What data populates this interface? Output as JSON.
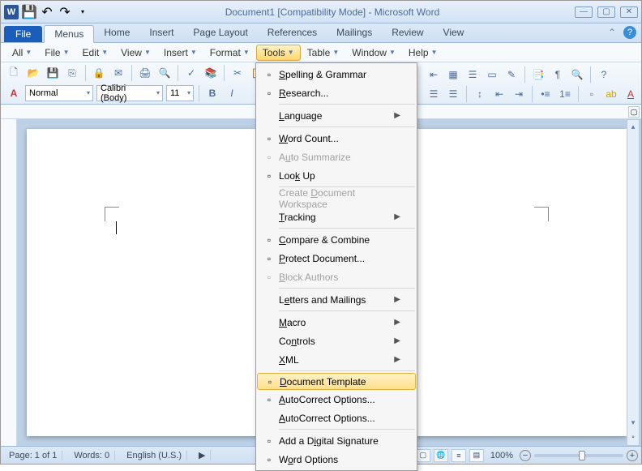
{
  "title": "Document1 [Compatibility Mode] - Microsoft Word",
  "ribbon_tabs": {
    "file": "File",
    "tabs": [
      "Menus",
      "Home",
      "Insert",
      "Page Layout",
      "References",
      "Mailings",
      "Review",
      "View"
    ],
    "active": "Menus"
  },
  "menubar": {
    "items": [
      "All",
      "File",
      "Edit",
      "View",
      "Insert",
      "Format",
      "Tools",
      "Table",
      "Window",
      "Help"
    ],
    "open": "Tools"
  },
  "format_bar": {
    "style_label": "Normal",
    "font_label": "Calibri (Body)",
    "size_label": "11",
    "style_prefix": "A"
  },
  "dropdown": [
    {
      "label": "Spelling & Grammar",
      "u": "S",
      "icon": "spellcheck-icon"
    },
    {
      "label": "Research...",
      "u": "R",
      "icon": "research-icon"
    },
    {
      "sep": true
    },
    {
      "label": "Language",
      "u": "L",
      "arrow": true
    },
    {
      "sep": true
    },
    {
      "label": "Word Count...",
      "u": "W",
      "icon": "wordcount-icon"
    },
    {
      "label": "Auto Summarize",
      "u": "u",
      "disabled": true,
      "icon": "summarize-icon"
    },
    {
      "label": "Look Up",
      "u": "k",
      "icon": "lookup-icon"
    },
    {
      "sep": true
    },
    {
      "label": "Create Document Workspace",
      "u": "D",
      "disabled": true
    },
    {
      "label": "Tracking",
      "u": "T",
      "arrow": true
    },
    {
      "sep": true
    },
    {
      "label": "Compare & Combine",
      "u": "C",
      "icon": "compare-icon"
    },
    {
      "label": "Protect Document...",
      "u": "P",
      "icon": "protect-icon"
    },
    {
      "label": "Block Authors",
      "u": "B",
      "disabled": true,
      "icon": "block-icon"
    },
    {
      "sep": true
    },
    {
      "label": "Letters and Mailings",
      "u": "e",
      "arrow": true
    },
    {
      "sep": true
    },
    {
      "label": "Macro",
      "u": "M",
      "arrow": true
    },
    {
      "label": "Controls",
      "u": "n",
      "arrow": true
    },
    {
      "label": "XML",
      "u": "X",
      "arrow": true
    },
    {
      "sep": true
    },
    {
      "label": "Document Template",
      "u": "D",
      "highlight": true,
      "icon": "template-icon"
    },
    {
      "label": "AutoCorrect Options...",
      "u": "A",
      "icon": "autocorrect-icon"
    },
    {
      "label": "AutoCorrect Options...",
      "u": "A"
    },
    {
      "sep": true
    },
    {
      "label": "Add a Digital Signature",
      "u": "i",
      "icon": "signature-icon"
    },
    {
      "label": "Word Options",
      "u": "O",
      "icon": "options-icon"
    }
  ],
  "status": {
    "page": "Page: 1 of 1",
    "words": "Words: 0",
    "lang": "English (U.S.)",
    "zoom": "100%"
  }
}
